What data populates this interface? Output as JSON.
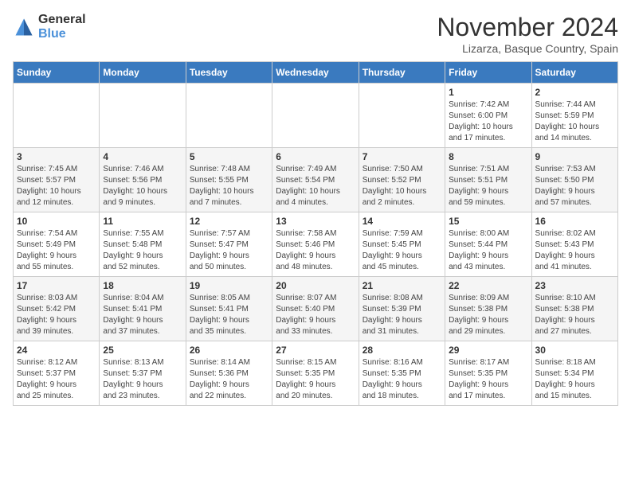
{
  "logo": {
    "general": "General",
    "blue": "Blue"
  },
  "title": "November 2024",
  "location": "Lizarza, Basque Country, Spain",
  "days_of_week": [
    "Sunday",
    "Monday",
    "Tuesday",
    "Wednesday",
    "Thursday",
    "Friday",
    "Saturday"
  ],
  "weeks": [
    [
      {
        "day": "",
        "info": ""
      },
      {
        "day": "",
        "info": ""
      },
      {
        "day": "",
        "info": ""
      },
      {
        "day": "",
        "info": ""
      },
      {
        "day": "",
        "info": ""
      },
      {
        "day": "1",
        "info": "Sunrise: 7:42 AM\nSunset: 6:00 PM\nDaylight: 10 hours\nand 17 minutes."
      },
      {
        "day": "2",
        "info": "Sunrise: 7:44 AM\nSunset: 5:59 PM\nDaylight: 10 hours\nand 14 minutes."
      }
    ],
    [
      {
        "day": "3",
        "info": "Sunrise: 7:45 AM\nSunset: 5:57 PM\nDaylight: 10 hours\nand 12 minutes."
      },
      {
        "day": "4",
        "info": "Sunrise: 7:46 AM\nSunset: 5:56 PM\nDaylight: 10 hours\nand 9 minutes."
      },
      {
        "day": "5",
        "info": "Sunrise: 7:48 AM\nSunset: 5:55 PM\nDaylight: 10 hours\nand 7 minutes."
      },
      {
        "day": "6",
        "info": "Sunrise: 7:49 AM\nSunset: 5:54 PM\nDaylight: 10 hours\nand 4 minutes."
      },
      {
        "day": "7",
        "info": "Sunrise: 7:50 AM\nSunset: 5:52 PM\nDaylight: 10 hours\nand 2 minutes."
      },
      {
        "day": "8",
        "info": "Sunrise: 7:51 AM\nSunset: 5:51 PM\nDaylight: 9 hours\nand 59 minutes."
      },
      {
        "day": "9",
        "info": "Sunrise: 7:53 AM\nSunset: 5:50 PM\nDaylight: 9 hours\nand 57 minutes."
      }
    ],
    [
      {
        "day": "10",
        "info": "Sunrise: 7:54 AM\nSunset: 5:49 PM\nDaylight: 9 hours\nand 55 minutes."
      },
      {
        "day": "11",
        "info": "Sunrise: 7:55 AM\nSunset: 5:48 PM\nDaylight: 9 hours\nand 52 minutes."
      },
      {
        "day": "12",
        "info": "Sunrise: 7:57 AM\nSunset: 5:47 PM\nDaylight: 9 hours\nand 50 minutes."
      },
      {
        "day": "13",
        "info": "Sunrise: 7:58 AM\nSunset: 5:46 PM\nDaylight: 9 hours\nand 48 minutes."
      },
      {
        "day": "14",
        "info": "Sunrise: 7:59 AM\nSunset: 5:45 PM\nDaylight: 9 hours\nand 45 minutes."
      },
      {
        "day": "15",
        "info": "Sunrise: 8:00 AM\nSunset: 5:44 PM\nDaylight: 9 hours\nand 43 minutes."
      },
      {
        "day": "16",
        "info": "Sunrise: 8:02 AM\nSunset: 5:43 PM\nDaylight: 9 hours\nand 41 minutes."
      }
    ],
    [
      {
        "day": "17",
        "info": "Sunrise: 8:03 AM\nSunset: 5:42 PM\nDaylight: 9 hours\nand 39 minutes."
      },
      {
        "day": "18",
        "info": "Sunrise: 8:04 AM\nSunset: 5:41 PM\nDaylight: 9 hours\nand 37 minutes."
      },
      {
        "day": "19",
        "info": "Sunrise: 8:05 AM\nSunset: 5:41 PM\nDaylight: 9 hours\nand 35 minutes."
      },
      {
        "day": "20",
        "info": "Sunrise: 8:07 AM\nSunset: 5:40 PM\nDaylight: 9 hours\nand 33 minutes."
      },
      {
        "day": "21",
        "info": "Sunrise: 8:08 AM\nSunset: 5:39 PM\nDaylight: 9 hours\nand 31 minutes."
      },
      {
        "day": "22",
        "info": "Sunrise: 8:09 AM\nSunset: 5:38 PM\nDaylight: 9 hours\nand 29 minutes."
      },
      {
        "day": "23",
        "info": "Sunrise: 8:10 AM\nSunset: 5:38 PM\nDaylight: 9 hours\nand 27 minutes."
      }
    ],
    [
      {
        "day": "24",
        "info": "Sunrise: 8:12 AM\nSunset: 5:37 PM\nDaylight: 9 hours\nand 25 minutes."
      },
      {
        "day": "25",
        "info": "Sunrise: 8:13 AM\nSunset: 5:37 PM\nDaylight: 9 hours\nand 23 minutes."
      },
      {
        "day": "26",
        "info": "Sunrise: 8:14 AM\nSunset: 5:36 PM\nDaylight: 9 hours\nand 22 minutes."
      },
      {
        "day": "27",
        "info": "Sunrise: 8:15 AM\nSunset: 5:35 PM\nDaylight: 9 hours\nand 20 minutes."
      },
      {
        "day": "28",
        "info": "Sunrise: 8:16 AM\nSunset: 5:35 PM\nDaylight: 9 hours\nand 18 minutes."
      },
      {
        "day": "29",
        "info": "Sunrise: 8:17 AM\nSunset: 5:35 PM\nDaylight: 9 hours\nand 17 minutes."
      },
      {
        "day": "30",
        "info": "Sunrise: 8:18 AM\nSunset: 5:34 PM\nDaylight: 9 hours\nand 15 minutes."
      }
    ]
  ]
}
